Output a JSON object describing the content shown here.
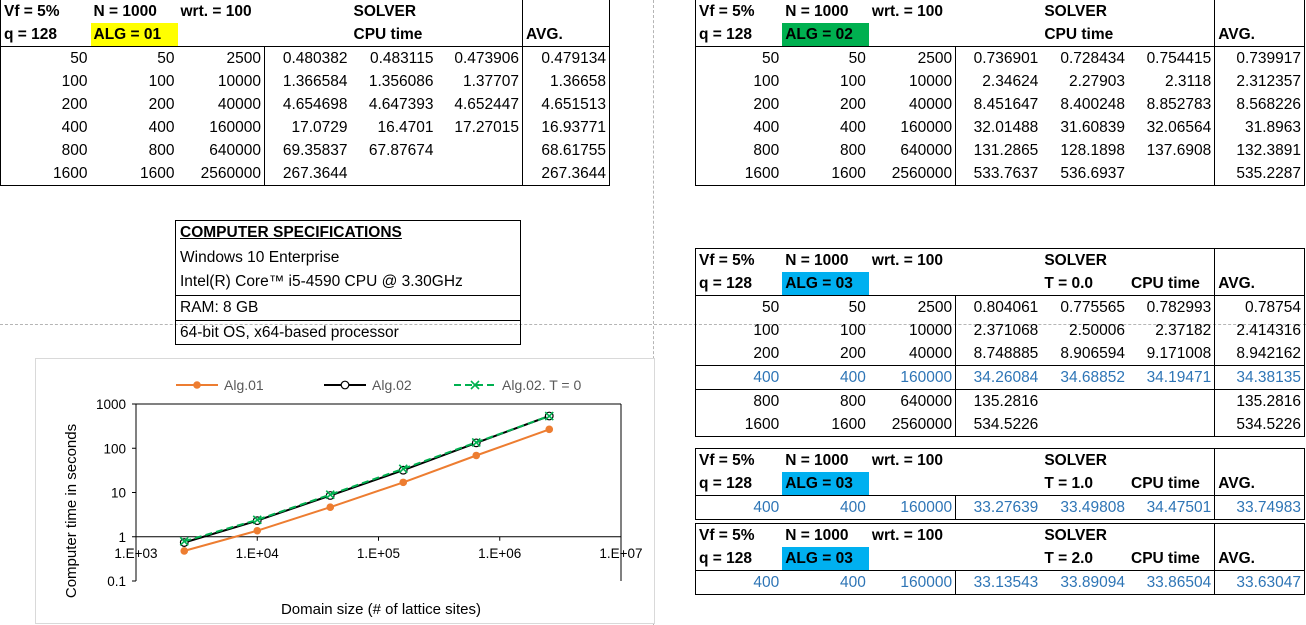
{
  "alg01": {
    "hdr": {
      "vf": "Vf = 5%",
      "n": "N = 1000",
      "wrt": "wrt. = 100",
      "solver": "SOLVER",
      "q": "q = 128",
      "alg": "ALG = 01",
      "cpu": "CPU time",
      "avg": "AVG."
    },
    "rows": [
      [
        "50",
        "50",
        "2500",
        "0.480382",
        "0.483115",
        "0.473906",
        "0.479134"
      ],
      [
        "100",
        "100",
        "10000",
        "1.366584",
        "1.356086",
        "1.37707",
        "1.36658"
      ],
      [
        "200",
        "200",
        "40000",
        "4.654698",
        "4.647393",
        "4.652447",
        "4.651513"
      ],
      [
        "400",
        "400",
        "160000",
        "17.0729",
        "16.4701",
        "17.27015",
        "16.93771"
      ],
      [
        "800",
        "800",
        "640000",
        "69.35837",
        "67.87674",
        "",
        "68.61755"
      ],
      [
        "1600",
        "1600",
        "2560000",
        "267.3644",
        "",
        "",
        "267.3644"
      ]
    ]
  },
  "alg02": {
    "hdr": {
      "vf": "Vf = 5%",
      "n": "N = 1000",
      "wrt": "wrt. = 100",
      "solver": "SOLVER",
      "q": "q = 128",
      "alg": "ALG = 02",
      "cpu": "CPU time",
      "avg": "AVG."
    },
    "rows": [
      [
        "50",
        "50",
        "2500",
        "0.736901",
        "0.728434",
        "0.754415",
        "0.739917"
      ],
      [
        "100",
        "100",
        "10000",
        "2.34624",
        "2.27903",
        "2.3118",
        "2.312357"
      ],
      [
        "200",
        "200",
        "40000",
        "8.451647",
        "8.400248",
        "8.852783",
        "8.568226"
      ],
      [
        "400",
        "400",
        "160000",
        "32.01488",
        "31.60839",
        "32.06564",
        "31.8963"
      ],
      [
        "800",
        "800",
        "640000",
        "131.2865",
        "128.1898",
        "137.6908",
        "132.3891"
      ],
      [
        "1600",
        "1600",
        "2560000",
        "533.7637",
        "536.6937",
        "",
        "535.2287"
      ]
    ]
  },
  "alg03": {
    "hdr": {
      "vf": "Vf = 5%",
      "n": "N = 1000",
      "wrt": "wrt. = 100",
      "solver": "SOLVER",
      "q": "q = 128",
      "alg": "ALG = 03",
      "t": "T = 0.0",
      "cpu": "CPU time",
      "avg": "AVG."
    },
    "rows": [
      [
        "50",
        "50",
        "2500",
        "0.804061",
        "0.775565",
        "0.782993",
        "0.78754"
      ],
      [
        "100",
        "100",
        "10000",
        "2.371068",
        "2.50006",
        "2.37182",
        "2.414316"
      ],
      [
        "200",
        "200",
        "40000",
        "8.748885",
        "8.906594",
        "9.171008",
        "8.942162"
      ],
      [
        "400",
        "400",
        "160000",
        "34.26084",
        "34.68852",
        "34.19471",
        "34.38135"
      ],
      [
        "800",
        "800",
        "640000",
        "135.2816",
        "",
        "",
        "135.2816"
      ],
      [
        "1600",
        "1600",
        "2560000",
        "534.5226",
        "",
        "",
        "534.5226"
      ]
    ]
  },
  "alg03_t1": {
    "hdr": {
      "vf": "Vf = 5%",
      "n": "N = 1000",
      "wrt": "wrt. = 100",
      "solver": "SOLVER",
      "q": "q = 128",
      "alg": "ALG = 03",
      "t": "T = 1.0",
      "cpu": "CPU time",
      "avg": "AVG."
    },
    "row": [
      "400",
      "400",
      "160000",
      "33.27639",
      "33.49808",
      "34.47501",
      "33.74983"
    ]
  },
  "alg03_t2": {
    "hdr": {
      "vf": "Vf = 5%",
      "n": "N = 1000",
      "wrt": "wrt. = 100",
      "solver": "SOLVER",
      "q": "q = 128",
      "alg": "ALG = 03",
      "t": "T = 2.0",
      "cpu": "CPU time",
      "avg": "AVG."
    },
    "row": [
      "400",
      "400",
      "160000",
      "33.13543",
      "33.89094",
      "33.86504",
      "33.63047"
    ]
  },
  "specs": {
    "title": "COMPUTER SPECIFICATIONS",
    "os": "Windows 10 Enterprise",
    "cpu": "Intel(R) Core™ i5-4590 CPU @ 3.30GHz",
    "ram": "RAM: 8 GB",
    "arch": "64-bit OS, x64-based processor"
  },
  "colors": {
    "yellow": "#ffff00",
    "green": "#00b050",
    "blue": "#00b0f0",
    "blue_text": "#2e75b6",
    "alg01": "#ed7d31",
    "alg02": "#000000",
    "alg02t": "#00b050"
  },
  "chart_data": {
    "type": "line",
    "xscale": "log",
    "yscale": "log",
    "xlabel": "Domain size (# of lattice sites)",
    "ylabel": "Computer time in seconds",
    "xticks": [
      "1.E+03",
      "1.E+04",
      "1.E+05",
      "1.E+06",
      "1.E+07"
    ],
    "yticks": [
      "0.1",
      "1",
      "10",
      "100",
      "1000"
    ],
    "xlim": [
      1000,
      10000000
    ],
    "ylim": [
      0.1,
      1000
    ],
    "legend": "top",
    "x": [
      2500,
      10000,
      40000,
      160000,
      640000,
      2560000
    ],
    "series": [
      {
        "name": "Alg.01",
        "values": [
          0.479134,
          1.36658,
          4.651513,
          16.93771,
          68.61755,
          267.3644
        ],
        "color": "#ed7d31",
        "marker": "dot",
        "dash": false
      },
      {
        "name": "Alg.02",
        "values": [
          0.739917,
          2.312357,
          8.568226,
          31.8963,
          132.3891,
          535.2287
        ],
        "color": "#000000",
        "marker": "circle",
        "dash": false
      },
      {
        "name": "Alg.02. T = 0",
        "values": [
          0.78754,
          2.414316,
          8.942162,
          34.38135,
          135.2816,
          534.5226
        ],
        "color": "#00b050",
        "marker": "x",
        "dash": true
      }
    ]
  }
}
